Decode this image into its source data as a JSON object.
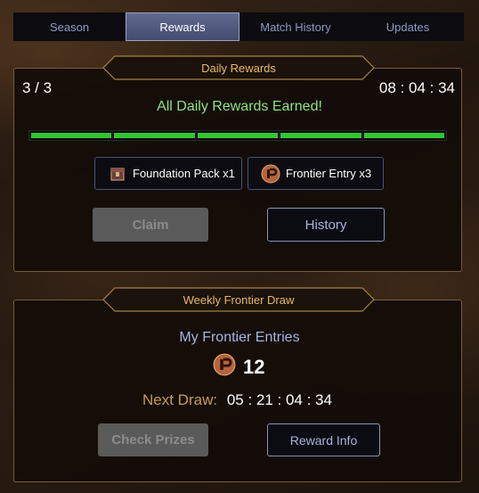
{
  "tabs": [
    {
      "label": "Season"
    },
    {
      "label": "Rewards"
    },
    {
      "label": "Match History"
    },
    {
      "label": "Updates"
    }
  ],
  "daily": {
    "title": "Daily Rewards",
    "counter": "3 / 3",
    "timer": "08 : 04 : 34",
    "status": "All Daily Rewards Earned!",
    "progress": {
      "completed": 5,
      "total": 5
    },
    "rewards": [
      {
        "label": "Foundation Pack x1",
        "icon": "foundation-pack-icon"
      },
      {
        "label": "Frontier Entry x3",
        "icon": "frontier-entry-icon"
      }
    ],
    "claim_label": "Claim",
    "history_label": "History"
  },
  "weekly": {
    "title": "Weekly Frontier Draw",
    "entries_label": "My Frontier Entries",
    "entries_count": "12",
    "next_draw_label": "Next Draw:",
    "next_draw_value": "05 : 21 : 04 : 34",
    "check_prizes_label": "Check Prizes",
    "reward_info_label": "Reward Info"
  },
  "colors": {
    "accent_gold": "#e9b95c",
    "progress_green": "#33c533",
    "earned_text": "#8fe27c",
    "button_outline": "#8a92b8"
  }
}
